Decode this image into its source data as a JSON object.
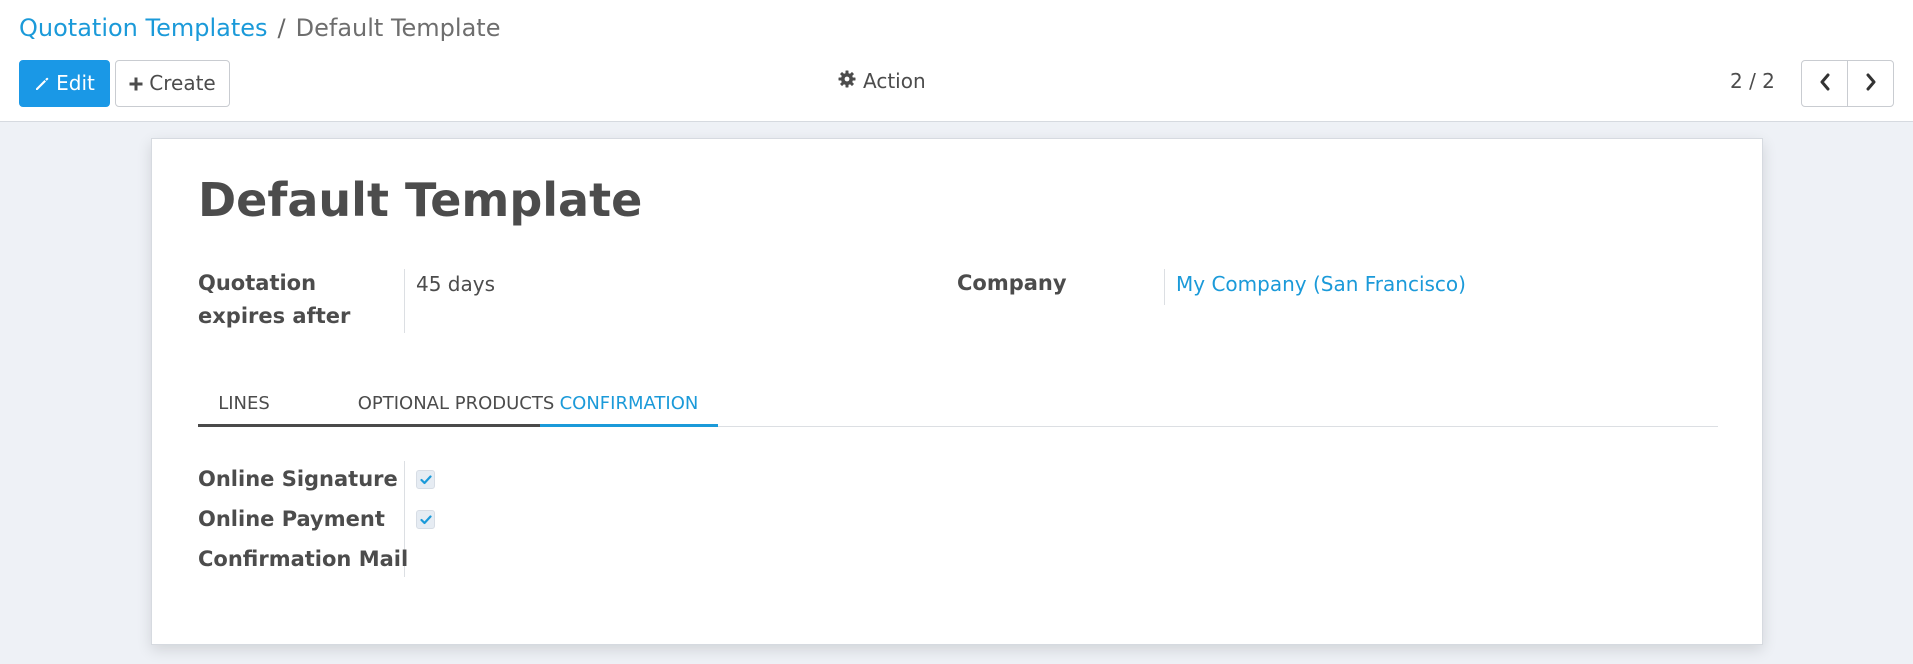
{
  "breadcrumb": {
    "parent": "Quotation Templates",
    "separator": "/",
    "current": "Default Template"
  },
  "toolbar": {
    "edit_label": "Edit",
    "create_label": "Create",
    "action_label": "Action",
    "edit_icon": "pencil-icon",
    "create_icon": "plus-icon",
    "action_icon": "gear-icon"
  },
  "pager": {
    "value": "2 / 2",
    "prev_icon": "chevron-left-icon",
    "next_icon": "chevron-right-icon"
  },
  "record": {
    "title": "Default Template",
    "fields": {
      "quotation_expires_label": "Quotation expires after",
      "quotation_expires_value": "45 days",
      "company_label": "Company",
      "company_value": "My Company (San Francisco)"
    }
  },
  "tabs": [
    {
      "label": "LINES",
      "active": false
    },
    {
      "label": "OPTIONAL PRODUCTS",
      "active": false
    },
    {
      "label": "CONFIRMATION",
      "active": true
    }
  ],
  "confirmation": {
    "online_signature_label": "Online Signature",
    "online_signature_checked": true,
    "online_payment_label": "Online Payment",
    "online_payment_checked": true,
    "confirmation_mail_label": "Confirmation Mail",
    "confirmation_mail_value": ""
  },
  "colors": {
    "accent": "#1a98e6",
    "link": "#1b9ad9",
    "text": "#4c4c4c",
    "background": "#eef1f6"
  }
}
